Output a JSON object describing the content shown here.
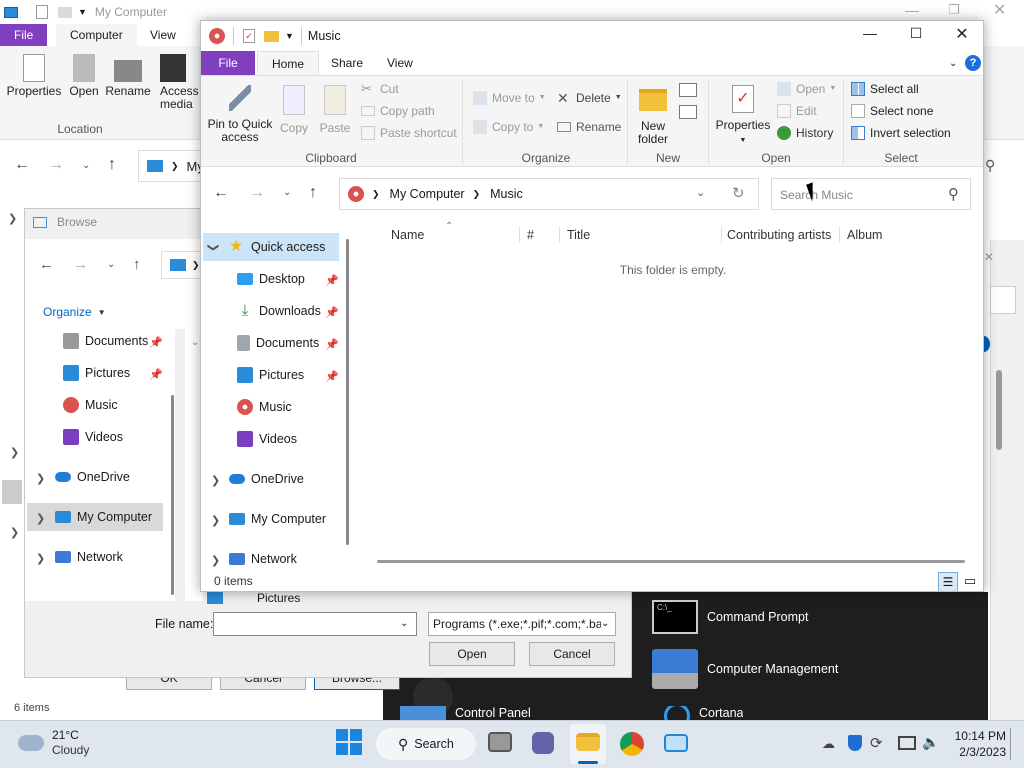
{
  "bg_window": {
    "title": "My Computer",
    "tabs": [
      "File",
      "Computer",
      "View"
    ],
    "ribbon": {
      "properties": "Properties",
      "open": "Open",
      "rename": "Rename",
      "access_media_1": "Access",
      "access_media_2": "media",
      "group_location": "Location"
    },
    "address_prefix": "My",
    "status": "6 items"
  },
  "browse_dialog": {
    "title": "Browse",
    "organize": "Organize",
    "nav": [
      "Documents",
      "Pictures",
      "Music",
      "Videos",
      "OneDrive",
      "My Computer",
      "Network"
    ],
    "peek_item": "Pictures",
    "file_name_label": "File name:",
    "file_name_value": "",
    "file_type": "Programs (*.exe;*.pif;*.com;*.ba",
    "open_btn": "Open",
    "cancel_btn": "Cancel",
    "back_ok": "OK",
    "back_cancel": "Cancel",
    "back_browse": "Browse..."
  },
  "start_menu": {
    "items": [
      "Command Prompt",
      "Computer Management",
      "Control Panel",
      "Cortana"
    ]
  },
  "main_window": {
    "title": "Music",
    "tabs": {
      "file": "File",
      "home": "Home",
      "share": "Share",
      "view": "View"
    },
    "ribbon": {
      "pin_1": "Pin to Quick",
      "pin_2": "access",
      "copy": "Copy",
      "paste": "Paste",
      "cut": "Cut",
      "copy_path": "Copy path",
      "paste_shortcut": "Paste shortcut",
      "group_clipboard": "Clipboard",
      "move_to": "Move to",
      "copy_to": "Copy to",
      "delete": "Delete",
      "rename": "Rename",
      "group_organize": "Organize",
      "new_folder_1": "New",
      "new_folder_2": "folder",
      "group_new": "New",
      "properties": "Properties",
      "open": "Open",
      "edit": "Edit",
      "history": "History",
      "group_open": "Open",
      "select_all": "Select all",
      "select_none": "Select none",
      "invert_selection": "Invert selection",
      "group_select": "Select"
    },
    "address": {
      "part1": "My Computer",
      "part2": "Music"
    },
    "search_placeholder": "Search Music",
    "nav": {
      "quick_access": "Quick access",
      "desktop": "Desktop",
      "downloads": "Downloads",
      "documents": "Documents",
      "pictures": "Pictures",
      "music": "Music",
      "videos": "Videos",
      "onedrive": "OneDrive",
      "my_computer": "My Computer",
      "network": "Network"
    },
    "columns": [
      "Name",
      "#",
      "Title",
      "Contributing artists",
      "Album"
    ],
    "empty_message": "This folder is empty.",
    "status": "0 items"
  },
  "taskbar": {
    "weather_temp": "21°C",
    "weather_desc": "Cloudy",
    "search_label": "Search",
    "time": "10:14 PM",
    "date": "2/3/2023"
  },
  "colors": {
    "file_tab": "#7f3fbf",
    "accent_blue": "#0067c0",
    "taskbar": "#dfe6ee"
  }
}
